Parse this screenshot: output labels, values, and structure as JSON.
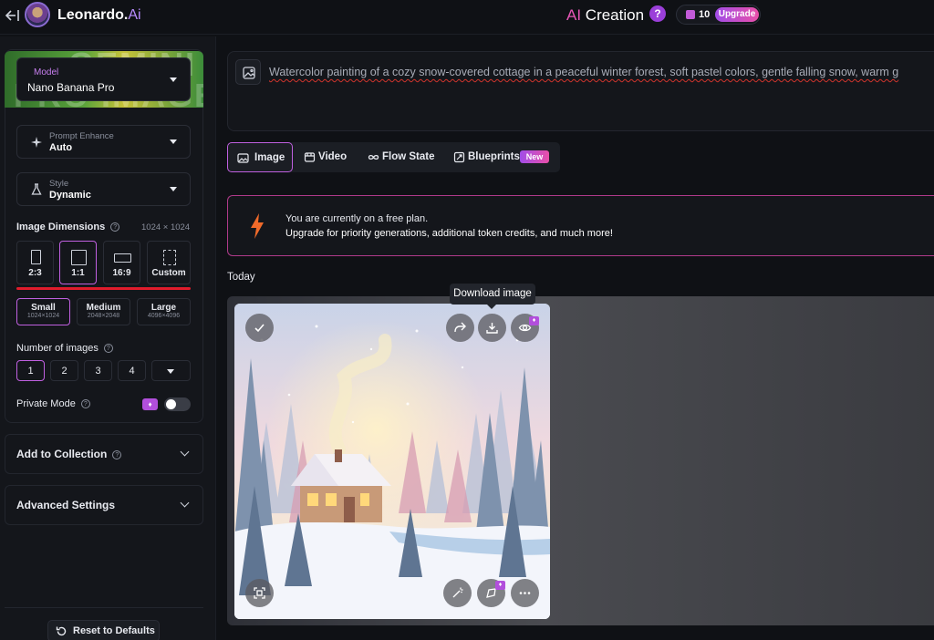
{
  "header": {
    "brand_name": "Leonardo.",
    "brand_ai": "Ai",
    "page_title_ai": "AI",
    "page_title_rest": " Creation",
    "help_glyph": "?",
    "tokens": "10",
    "upgrade_label": "Upgrade"
  },
  "sidebar": {
    "model": {
      "label": "Model",
      "value": "Nano Banana Pro",
      "banner_line1": "GEMINI 3",
      "banner_line2": "PRO IMAGE"
    },
    "prompt_enhance": {
      "label": "Prompt Enhance",
      "value": "Auto"
    },
    "style": {
      "label": "Style",
      "value": "Dynamic"
    },
    "image_dimensions": {
      "label": "Image Dimensions",
      "readout": "1024 × 1024",
      "ratios": [
        "2:3",
        "1:1",
        "16:9",
        "Custom"
      ],
      "selected_ratio": "1:1",
      "sizes": [
        {
          "name": "Small",
          "res": "1024×1024"
        },
        {
          "name": "Medium",
          "res": "2048×2048"
        },
        {
          "name": "Large",
          "res": "4096×4096"
        }
      ],
      "selected_size": "Small"
    },
    "number_of_images": {
      "label": "Number of images",
      "options": [
        "1",
        "2",
        "3",
        "4"
      ],
      "selected": "1"
    },
    "private_mode": {
      "label": "Private Mode",
      "enabled": false
    },
    "add_to_collection": "Add to Collection",
    "advanced_settings": "Advanced Settings",
    "reset_label": "Reset to Defaults"
  },
  "prompt": {
    "text": "Watercolor painting of a cozy snow-covered cottage in a peaceful winter forest, soft pastel colors, gentle falling snow, warm g"
  },
  "tabs": [
    {
      "label": "Image",
      "icon": "image-icon",
      "active": true
    },
    {
      "label": "Video",
      "icon": "video-icon",
      "active": false
    },
    {
      "label": "Flow State",
      "icon": "infinity-icon",
      "active": false
    },
    {
      "label": "Blueprints",
      "icon": "blueprint-icon",
      "active": false,
      "badge": "New"
    }
  ],
  "banner": {
    "line1": "You are currently on a free plan.",
    "line2": "Upgrade for priority generations, additional token credits, and much more!"
  },
  "gallery": {
    "date_label": "Today",
    "tooltip": "Download image"
  },
  "colors": {
    "accent": "#c060e0",
    "upgrade_gradient_start": "#a14de8",
    "upgrade_gradient_end": "#e94fa8",
    "danger_underline": "#e01c2c"
  }
}
